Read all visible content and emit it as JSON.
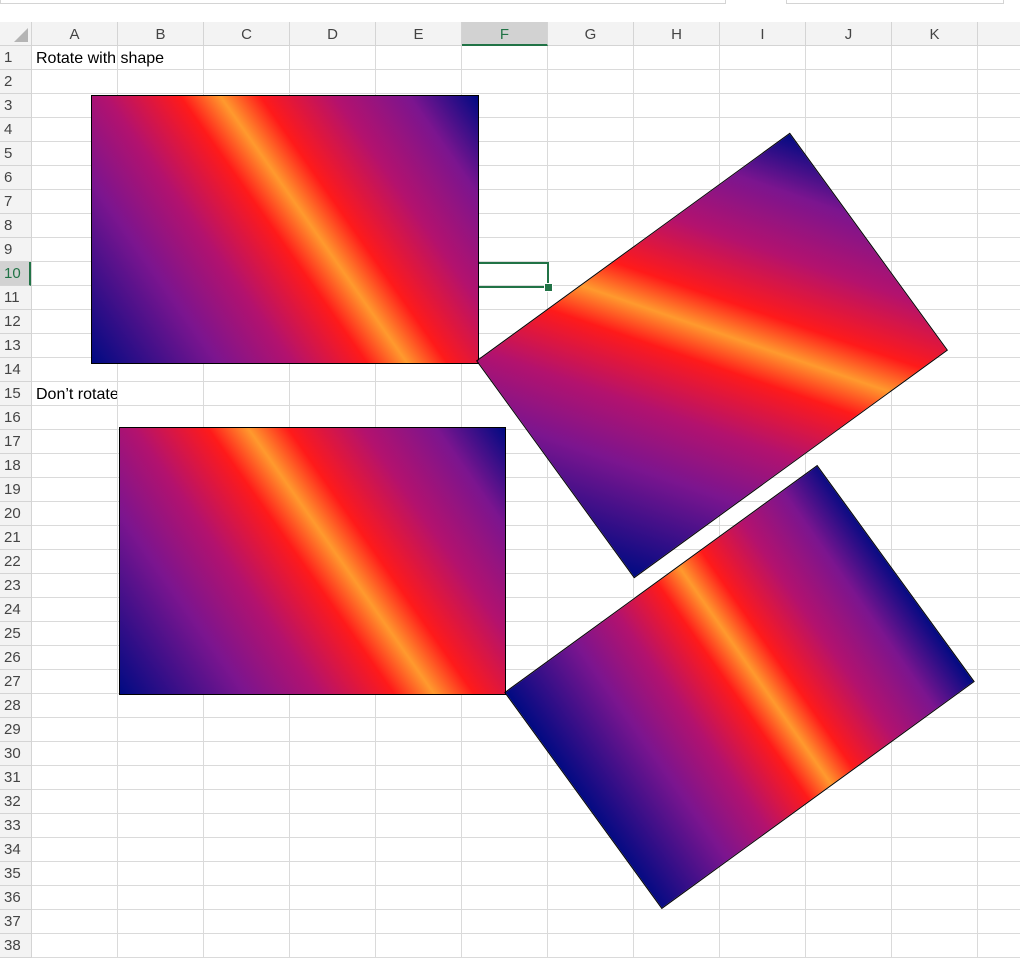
{
  "spreadsheet": {
    "columns": [
      "A",
      "B",
      "C",
      "D",
      "E",
      "F",
      "G",
      "H",
      "I",
      "J",
      "K"
    ],
    "selected_column": "F",
    "rows": [
      "1",
      "2",
      "3",
      "4",
      "5",
      "6",
      "7",
      "8",
      "9",
      "10",
      "11",
      "12",
      "13",
      "14",
      "15",
      "16",
      "17",
      "18",
      "19",
      "20",
      "21",
      "22",
      "23",
      "24",
      "25",
      "26",
      "27",
      "28",
      "29",
      "30",
      "31",
      "32",
      "33",
      "34",
      "35",
      "36",
      "37",
      "38"
    ],
    "selected_row": "10",
    "active_cell": "F10",
    "cells": {
      "A1": "Rotate with shape",
      "A15": "Don’t rotate"
    }
  },
  "shapes": {
    "fill": {
      "type": "linear-gradient",
      "colors": [
        "#000a82",
        "#7b158f",
        "#b3126e",
        "#ff1a1a",
        "#ff9a2e",
        "#ff1a1a",
        "#b3126e",
        "#7b158f",
        "#000a82"
      ]
    },
    "outline_color": "#000000",
    "items": [
      {
        "name": "rectangle-rotate-with-shape",
        "rotation_deg": 0,
        "gradient_rotates": true
      },
      {
        "name": "rectangle-rotate-with-shape-rotated",
        "rotation_deg": -36,
        "gradient_rotates": true
      },
      {
        "name": "rectangle-dont-rotate",
        "rotation_deg": 0,
        "gradient_rotates": false
      },
      {
        "name": "rectangle-dont-rotate-rotated",
        "rotation_deg": -36,
        "gradient_rotates": false
      }
    ]
  }
}
